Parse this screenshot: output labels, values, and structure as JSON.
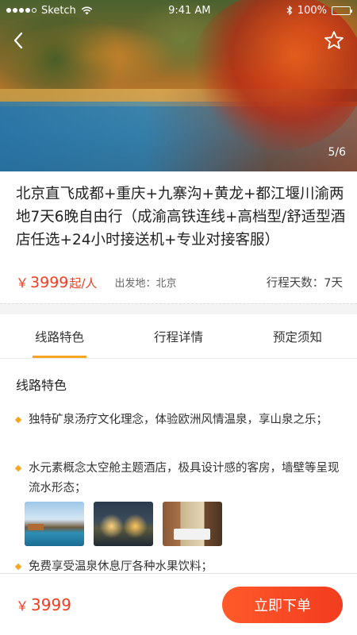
{
  "statusbar": {
    "carrier": "Sketch",
    "time": "9:41 AM",
    "battery": "100%",
    "icons": [
      "signal-icon",
      "wifi-icon",
      "bluetooth-icon",
      "battery-icon"
    ]
  },
  "hero": {
    "counter": "5/6",
    "back_icon": "back-arrow-icon",
    "favorite_icon": "star-outline-icon"
  },
  "product": {
    "title": "北京直飞成都+重庆+九寨沟+黄龙+都江堰川渝两地7天6晚自由行（成渝高铁连线+高档型/舒适型酒店任选+24小时接送机+专业对接客服）",
    "currency": "￥",
    "price": "3999",
    "price_unit": "起/人",
    "departure": "出发地：北京",
    "days": "行程天数：7天"
  },
  "tabs": [
    {
      "label": "线路特色",
      "active": true
    },
    {
      "label": "行程详情",
      "active": false
    },
    {
      "label": "预定须知",
      "active": false
    }
  ],
  "content": {
    "section_title": "线路特色",
    "features": [
      "独特矿泉汤疗文化理念，体验欧洲风情温泉，享山泉之乐；",
      "水元素概念太空舱主题酒店，极具设计感的客房，墙壁等呈现流水形态；",
      "免费享受温泉休息厅各种水果饮料；"
    ],
    "thumbnails": [
      "pool-photo",
      "resort-night-photo",
      "hotel-room-photo"
    ]
  },
  "bottom_bar": {
    "currency": "￥",
    "price": "3999",
    "buy_label": "立即下单"
  },
  "colors": {
    "accent_orange": "#f5a623",
    "price_red": "#f23c1f"
  }
}
